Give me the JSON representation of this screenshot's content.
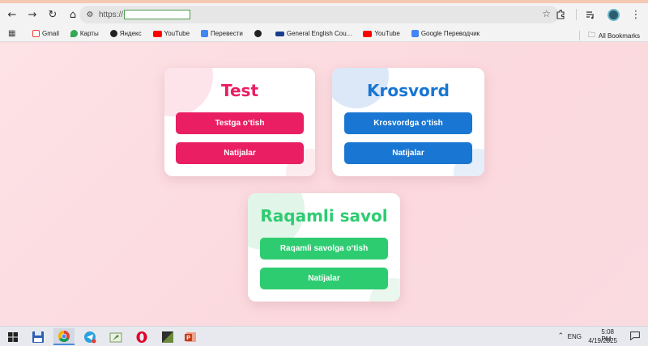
{
  "browser": {
    "url_prefix": "https://",
    "url_value": "",
    "bookmarks": [
      {
        "label": "Gmail",
        "color": "#ea4335"
      },
      {
        "label": "Карты",
        "color": "#34a853"
      },
      {
        "label": "Яндекс",
        "color": "#222222"
      },
      {
        "label": "YouTube",
        "color": "#ff0000"
      },
      {
        "label": "Перевести",
        "color": "#4285f4"
      },
      {
        "label": "",
        "color": "#222222"
      },
      {
        "label": "General English Cou...",
        "color": "#1a3d8f"
      },
      {
        "label": "YouTube",
        "color": "#ff0000"
      },
      {
        "label": "Google Переводчик",
        "color": "#4285f4"
      }
    ],
    "all_bookmarks": "All Bookmarks"
  },
  "cards": {
    "test": {
      "title": "Test",
      "primary_label": "Testga o‘tish",
      "results_label": "Natijalar",
      "color": "#e91e63"
    },
    "krosvord": {
      "title": "Krosvord",
      "primary_label": "Krosvordga o‘tish",
      "results_label": "Natijalar",
      "color": "#1976d2"
    },
    "raqamli": {
      "title": "Raqamli savol",
      "primary_label": "Raqamli savolga o‘tish",
      "results_label": "Natijalar",
      "color": "#2ecc71"
    }
  },
  "taskbar": {
    "lang": "ENG",
    "time": "5:08 PM",
    "date": "4/19/2025"
  }
}
